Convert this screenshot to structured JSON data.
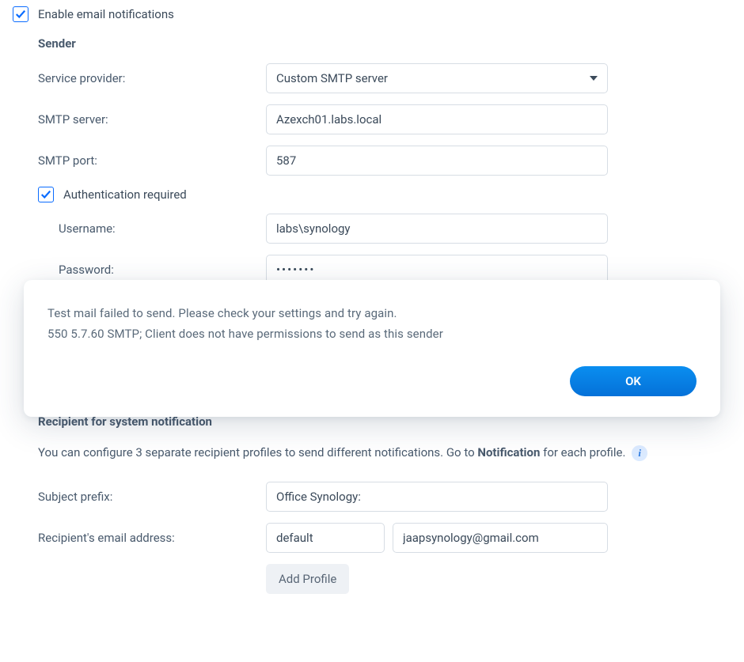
{
  "enable_label": "Enable email notifications",
  "sender": {
    "heading": "Sender",
    "service_provider_label": "Service provider:",
    "service_provider_value": "Custom SMTP server",
    "smtp_server_label": "SMTP server:",
    "smtp_server_value": "Azexch01.labs.local",
    "smtp_port_label": "SMTP port:",
    "smtp_port_value": "587",
    "auth_required_label": "Authentication required",
    "username_label": "Username:",
    "username_value": "labs\\synology",
    "password_label": "Password:",
    "password_value": "•••••••"
  },
  "recipient": {
    "heading": "Recipient for system notification",
    "description_prefix": "You can configure 3 separate recipient profiles to send different notifications. Go to ",
    "description_bold": "Notification",
    "description_suffix": " for each profile.",
    "subject_prefix_label": "Subject prefix:",
    "subject_prefix_value": "Office Synology:",
    "email_label": "Recipient's email address:",
    "profile_name": "default",
    "email_value": "jaapsynology@gmail.com",
    "add_profile_label": "Add Profile"
  },
  "dialog": {
    "message_line1": "Test mail failed to send. Please check your settings and try again.",
    "message_line2": "550 5.7.60 SMTP; Client does not have permissions to send as this sender",
    "ok_label": "OK"
  }
}
